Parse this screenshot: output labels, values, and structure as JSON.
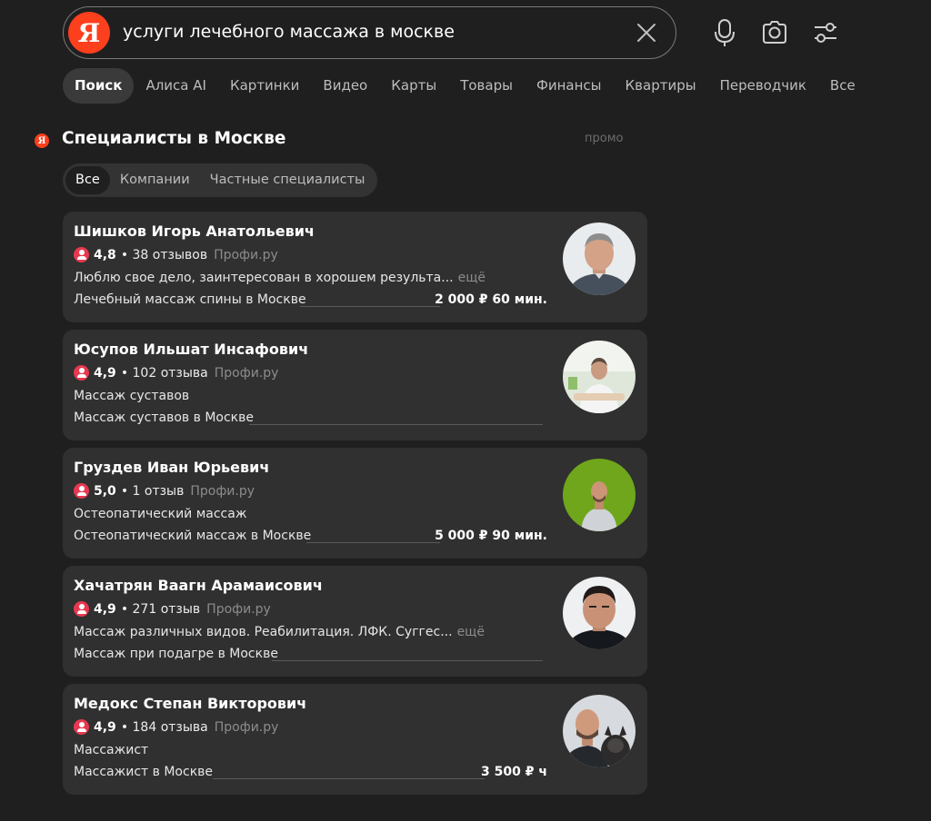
{
  "search": {
    "logo": "Я",
    "query": "услуги лечебного массажа в москве"
  },
  "icons": {
    "clear": "close-icon",
    "voice": "microphone-icon",
    "camera": "camera-icon",
    "filters": "settings-sliders-icon"
  },
  "tabs": [
    {
      "label": "Поиск",
      "active": true
    },
    {
      "label": "Алиса AI"
    },
    {
      "label": "Картинки"
    },
    {
      "label": "Видео"
    },
    {
      "label": "Карты"
    },
    {
      "label": "Товары"
    },
    {
      "label": "Финансы"
    },
    {
      "label": "Квартиры"
    },
    {
      "label": "Переводчик"
    },
    {
      "label": "Все"
    }
  ],
  "section": {
    "icon_letter": "Я",
    "title": "Специалисты в Москве",
    "promo": "промо",
    "filters": [
      {
        "label": "Все",
        "active": true
      },
      {
        "label": "Компании"
      },
      {
        "label": "Частные специалисты"
      }
    ]
  },
  "colors": {
    "background": "#1f1f1f",
    "card": "#303030",
    "brand": "#fc3f1d",
    "rating_icon": "#e8384f"
  },
  "specialists": [
    {
      "name": "Шишков Игорь Анатольевич",
      "rating": "4,8",
      "reviews": "• 38 отзывов",
      "source": "Профи.ру",
      "description": "Люблю свое дело, заинтересован в хорошем результа...",
      "more": "ещё",
      "service": "Лечебный массаж спины в Москве",
      "price": "2 000 ₽ 60 мин."
    },
    {
      "name": "Юсупов Ильшат Инсафович",
      "rating": "4,9",
      "reviews": "• 102 отзыва",
      "source": "Профи.ру",
      "description": "Массаж суставов",
      "more": "",
      "service": "Массаж суставов в Москве",
      "price": ""
    },
    {
      "name": "Груздев Иван Юрьевич",
      "rating": "5,0",
      "reviews": "• 1 отзыв",
      "source": "Профи.ру",
      "description": "Остеопатический массаж",
      "more": "",
      "service": "Остеопатический массаж в Москве",
      "price": "5 000 ₽ 90 мин."
    },
    {
      "name": "Хачатрян Ваагн Арамаисович",
      "rating": "4,9",
      "reviews": "• 271 отзыв",
      "source": "Профи.ру",
      "description": "Массаж различных видов. Реабилитация. ЛФК. Суггес...",
      "more": "ещё",
      "service": "Массаж при подагре в Москве",
      "price": ""
    },
    {
      "name": "Медокс Степан Викторович",
      "rating": "4,9",
      "reviews": "• 184 отзыва",
      "source": "Профи.ру",
      "description": "Массажист",
      "more": "",
      "service": "Массажист в Москве",
      "price": "3 500 ₽ ч"
    }
  ]
}
